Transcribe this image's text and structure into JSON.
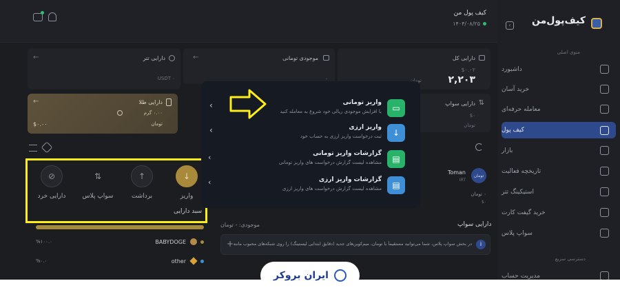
{
  "brand": {
    "name": "کیف‌پول‌من",
    "collapse_icon": "chevron-left-icon"
  },
  "header": {
    "wallet_title": "کیف پول من",
    "date": "۱۴۰۴/۰۸/۲۵"
  },
  "sidebar": {
    "section_main": "منوی اصلی",
    "section_fast": "دسترسی سریع",
    "items": [
      {
        "label": "داشبورد",
        "icon": "grid-icon"
      },
      {
        "label": "خرید آسان",
        "icon": "cart-icon"
      },
      {
        "label": "معامله حرفه‌ای",
        "icon": "chart-icon"
      },
      {
        "label": "کیف پول",
        "icon": "wallet-icon"
      },
      {
        "label": "بازار",
        "icon": "market-icon"
      },
      {
        "label": "تاریخچه فعالیت",
        "icon": "history-icon"
      },
      {
        "label": "استیکینگ تتر",
        "icon": "staking-icon"
      },
      {
        "label": "خرید گیفت کارت",
        "icon": "gift-icon"
      },
      {
        "label": "سواپ پلاس",
        "icon": "swap-icon"
      },
      {
        "label": "مدیریت حساب",
        "icon": "account-icon"
      }
    ]
  },
  "cards": {
    "total": {
      "title": "دارایی کل",
      "sub": "$۰.۰۲",
      "value": "۲,۲۰۳",
      "unit": "تومان"
    },
    "toman": {
      "title": "موجودی تومانی",
      "value": "۰",
      "unit": "تومان"
    },
    "tether": {
      "title": "دارایی تتر",
      "value": "USDT ۰"
    },
    "swap": {
      "title": "دارایی سواپ",
      "sub": "$۰",
      "unit": "تومان"
    },
    "gold": {
      "title": "دارایی طلا",
      "grams": "۰.۰۰ گرم",
      "value": "$۰.۰۰",
      "unit": "تومان"
    }
  },
  "quick_actions": [
    {
      "label": "واریز",
      "icon": "deposit-icon"
    },
    {
      "label": "برداشت",
      "icon": "withdraw-icon"
    },
    {
      "label": "سواپ پلاس",
      "icon": "swap-icon"
    },
    {
      "label": "دارایی خرد",
      "icon": "small-assets-icon"
    }
  ],
  "basket": {
    "title": "سبد دارایی",
    "rows": [
      {
        "name": "BABYDOGE",
        "pct": "%۱۰۰.۰"
      },
      {
        "name": "other",
        "pct": "%۰.۰"
      }
    ]
  },
  "swap_section": {
    "title": "دارایی سواپ",
    "balance": "موجودی: - تومان",
    "info": "در بخش سواپ پلاس، شما می‌توانید مستقیماً با تومان، میم‌کوین‌های جدید (دقایق ابتدایی لیستینگ) را روی شبکه‌های محبوب مانند ..."
  },
  "toman_row": {
    "name": "Toman",
    "code": "IRT",
    "value": "۰ تومان",
    "sub": "$۰",
    "badge": "تومان"
  },
  "popup": {
    "items": [
      {
        "title": "واریز تومانی",
        "desc": "با افزایش موجودی ریالی خود شروع به معامله کنید",
        "icon": "card-icon",
        "color": "#29b36a"
      },
      {
        "title": "واریز ارزی",
        "desc": "ثبت درخواست واریز ارزی به حساب خود",
        "icon": "download-icon",
        "color": "#3f8fd6"
      },
      {
        "title": "گزارشات واریز تومانی",
        "desc": "مشاهده لیست گزارش درخواست های واریز تومانی",
        "icon": "report-icon",
        "color": "#29b36a"
      },
      {
        "title": "گزارشات واریز ارزی",
        "desc": "مشاهده لیست گزارش درخواست های واریز ارزی",
        "icon": "report-icon",
        "color": "#3f8fd6"
      }
    ]
  },
  "watermark": {
    "text": "ایران بروکر"
  },
  "colors": {
    "highlight": "#ffed1a",
    "accent": "#2f4a8c",
    "gold": "#a98a3b"
  }
}
